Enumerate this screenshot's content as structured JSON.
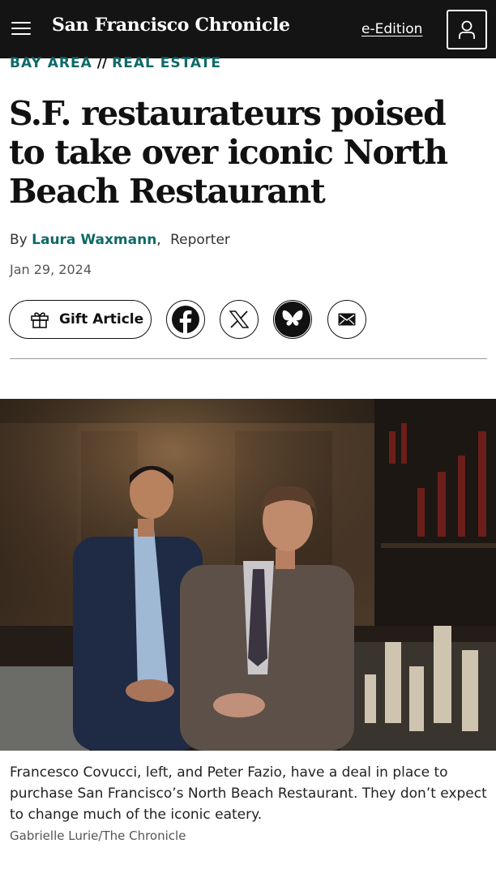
{
  "header": {
    "logo": "San Francisco Chronicle",
    "eedition_label": "e-Edition",
    "menu_icon": "hamburger-menu-icon",
    "account_icon": "user-icon",
    "background": "#141414"
  },
  "article": {
    "kicker": {
      "region": "BAY AREA",
      "separator": "//",
      "section": "REAL ESTATE"
    },
    "headline": "S.F. restaurateurs poised to take over iconic North Beach Restaurant",
    "byline": {
      "prefix": "By",
      "author": "Laura Waxmann",
      "separator": ",",
      "role": "Reporter"
    },
    "date": "Jan 29, 2024",
    "accent_color": "#0e6a66"
  },
  "share": {
    "gift_label": "Gift Article",
    "gift_icon": "gift-icon",
    "buttons": [
      {
        "icon": "facebook-icon"
      },
      {
        "icon": "x-icon"
      },
      {
        "icon": "bluesky-icon"
      },
      {
        "icon": "email-icon"
      }
    ]
  },
  "photo": {
    "caption": "Francesco Covucci, left, and Peter Fazio, have a deal in place to purchase San Francisco’s North Beach Restaurant. They don’t expect to change much of the iconic eatery.",
    "credit": "Gabrielle Lurie/The Chronicle"
  }
}
